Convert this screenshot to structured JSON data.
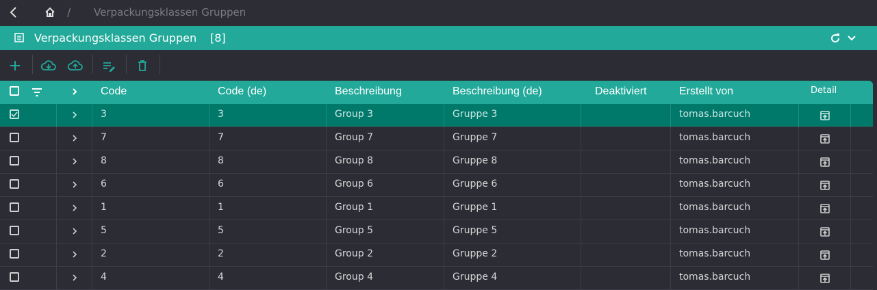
{
  "breadcrumb": {
    "separator": "/",
    "current": "Verpackungsklassen Gruppen"
  },
  "panel": {
    "title": "Verpackungsklassen Gruppen",
    "count": "[8]"
  },
  "columns": {
    "code": "Code",
    "code_de": "Code (de)",
    "beschreibung": "Beschreibung",
    "beschreibung_de": "Beschreibung (de)",
    "deaktiviert": "Deaktiviert",
    "erstellt_von": "Erstellt von",
    "detail": "Detail"
  },
  "rows": [
    {
      "code": "3",
      "code_de": "3",
      "beschreibung": "Group 3",
      "beschreibung_de": "Gruppe 3",
      "deaktiviert": "",
      "erstellt_von": "tomas.barcuch",
      "selected": true
    },
    {
      "code": "7",
      "code_de": "7",
      "beschreibung": "Group 7",
      "beschreibung_de": "Gruppe 7",
      "deaktiviert": "",
      "erstellt_von": "tomas.barcuch",
      "selected": false
    },
    {
      "code": "8",
      "code_de": "8",
      "beschreibung": "Group 8",
      "beschreibung_de": "Gruppe 8",
      "deaktiviert": "",
      "erstellt_von": "tomas.barcuch",
      "selected": false
    },
    {
      "code": "6",
      "code_de": "6",
      "beschreibung": "Group 6",
      "beschreibung_de": "Gruppe 6",
      "deaktiviert": "",
      "erstellt_von": "tomas.barcuch",
      "selected": false
    },
    {
      "code": "1",
      "code_de": "1",
      "beschreibung": "Group 1",
      "beschreibung_de": "Gruppe 1",
      "deaktiviert": "",
      "erstellt_von": "tomas.barcuch",
      "selected": false
    },
    {
      "code": "5",
      "code_de": "5",
      "beschreibung": "Group 5",
      "beschreibung_de": "Gruppe 5",
      "deaktiviert": "",
      "erstellt_von": "tomas.barcuch",
      "selected": false
    },
    {
      "code": "2",
      "code_de": "2",
      "beschreibung": "Group 2",
      "beschreibung_de": "Gruppe 2",
      "deaktiviert": "",
      "erstellt_von": "tomas.barcuch",
      "selected": false
    },
    {
      "code": "4",
      "code_de": "4",
      "beschreibung": "Group 4",
      "beschreibung_de": "Gruppe 4",
      "deaktiviert": "",
      "erstellt_von": "tomas.barcuch",
      "selected": false
    }
  ],
  "icons": {
    "back": "chevron-left-icon",
    "home": "home-icon",
    "list": "list-icon",
    "refresh": "refresh-icon",
    "collapse": "chevron-down-icon",
    "add": "plus-icon",
    "download": "cloud-download-icon",
    "upload": "cloud-upload-icon",
    "edit": "edit-list-icon",
    "delete": "trash-icon",
    "filter": "filter-icon",
    "expand": "chevron-right-icon",
    "detail": "open-in-new-icon"
  },
  "colors": {
    "accent": "#22a99a",
    "selected_row": "#00796b",
    "background": "#2b2c34"
  }
}
